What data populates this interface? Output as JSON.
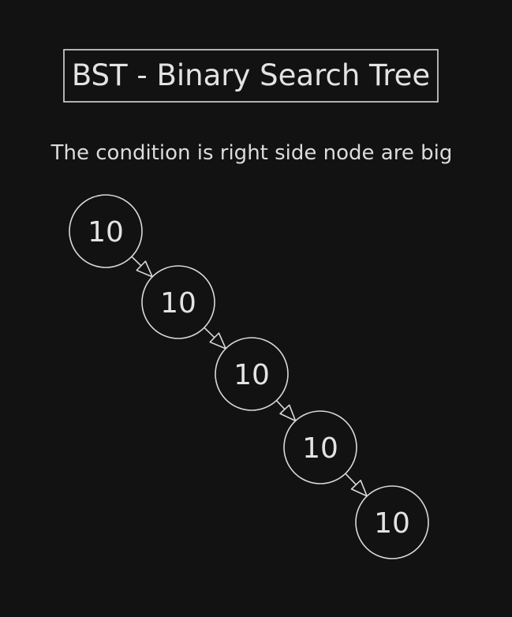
{
  "title": "BST - Binary Search Tree",
  "subtitle": "The condition is right side node are big",
  "colors": {
    "background": "#121212",
    "stroke": "#d9d9d9",
    "text": "#e3e3e3"
  },
  "nodes": [
    {
      "id": "n1",
      "label": "10"
    },
    {
      "id": "n2",
      "label": "10"
    },
    {
      "id": "n3",
      "label": "10"
    },
    {
      "id": "n4",
      "label": "10"
    },
    {
      "id": "n5",
      "label": "10"
    }
  ],
  "edges": [
    {
      "from": "n1",
      "to": "n2",
      "side": "right"
    },
    {
      "from": "n2",
      "to": "n3",
      "side": "right"
    },
    {
      "from": "n3",
      "to": "n4",
      "side": "right"
    },
    {
      "from": "n4",
      "to": "n5",
      "side": "right"
    }
  ]
}
